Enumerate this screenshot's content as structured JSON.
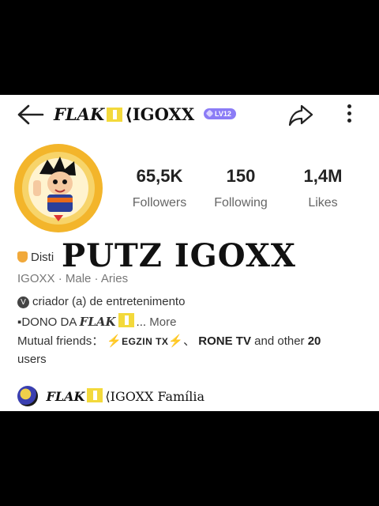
{
  "header": {
    "title_part1": "FLAK",
    "title_part2": "IGOXX",
    "level_badge": "LV12",
    "back_icon": "arrow-left-icon",
    "share_icon": "share-arrow-icon",
    "more_icon": "more-vertical-icon"
  },
  "stats": [
    {
      "value": "65,5K",
      "label": "Followers"
    },
    {
      "value": "150",
      "label": "Following"
    },
    {
      "value": "1,4M",
      "label": "Likes"
    }
  ],
  "overlay_text": "PUTZ IGOXX",
  "profile": {
    "badge_text": "Disti",
    "username": "IGOXX",
    "gender": "Male",
    "zodiac": "Aries",
    "separator": "·",
    "category": "criador (a) de entretenimento",
    "bio_prefix": "▪DONO DA ",
    "bio_name": "FLAK",
    "bio_ellipsis": "...",
    "more_label": "More"
  },
  "mutual": {
    "label": "Mutual friends：",
    "friend1": "EGZIN TX",
    "sep": "、",
    "friend2": "RONE TV",
    "and_other": "and other",
    "count": "20",
    "suffix": "users"
  },
  "family": {
    "name_part1": "FLAK",
    "name_part2": "IGOXX",
    "label": "Família"
  },
  "colors": {
    "accent": "#8b7cf6",
    "badge": "#f1a93b",
    "bolt": "#f2b400"
  }
}
